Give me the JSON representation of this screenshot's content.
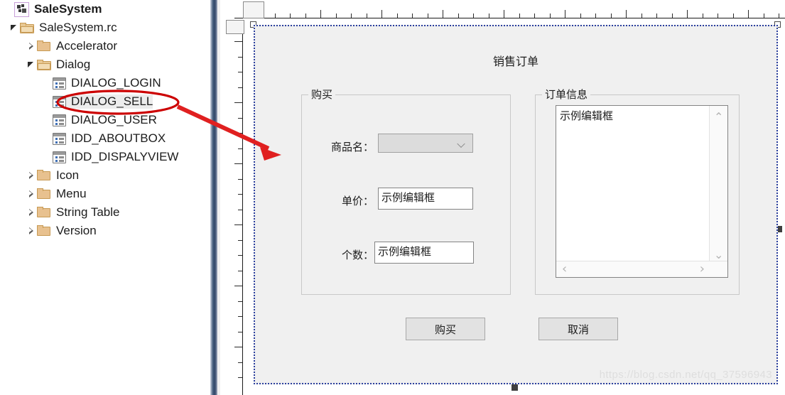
{
  "explorer": {
    "root": {
      "label": "SaleSystem",
      "icon": "project-icon"
    },
    "items": [
      {
        "label": "SaleSystem.rc",
        "icon": "folder-open-icon",
        "indent": 1,
        "expander": "expanded"
      },
      {
        "label": "Accelerator",
        "icon": "folder-icon",
        "indent": 2,
        "expander": "collapsed"
      },
      {
        "label": "Dialog",
        "icon": "folder-open-icon",
        "indent": 2,
        "expander": "expanded"
      },
      {
        "label": "DIALOG_LOGIN",
        "icon": "dialog-icon",
        "indent": 3,
        "expander": "none"
      },
      {
        "label": "DIALOG_SELL",
        "icon": "dialog-icon",
        "indent": 3,
        "expander": "none",
        "selected": true
      },
      {
        "label": "DIALOG_USER",
        "icon": "dialog-icon",
        "indent": 3,
        "expander": "none"
      },
      {
        "label": "IDD_ABOUTBOX",
        "icon": "dialog-icon",
        "indent": 3,
        "expander": "none"
      },
      {
        "label": "IDD_DISPALYVIEW",
        "icon": "dialog-icon",
        "indent": 3,
        "expander": "none"
      },
      {
        "label": "Icon",
        "icon": "folder-icon",
        "indent": 2,
        "expander": "collapsed"
      },
      {
        "label": "Menu",
        "icon": "folder-icon",
        "indent": 2,
        "expander": "collapsed"
      },
      {
        "label": "String Table",
        "icon": "folder-icon",
        "indent": 2,
        "expander": "collapsed"
      },
      {
        "label": "Version",
        "icon": "folder-icon",
        "indent": 2,
        "expander": "collapsed"
      }
    ]
  },
  "designer": {
    "dialog_title": "销售订单",
    "group_left": {
      "title": "购买"
    },
    "group_right": {
      "title": "订单信息"
    },
    "fields": [
      {
        "label": "商品名：",
        "control": "combo",
        "value": ""
      },
      {
        "label": "单价：",
        "control": "edit",
        "value": "示例编辑框"
      },
      {
        "label": "个数：",
        "control": "edit",
        "value": "示例编辑框"
      }
    ],
    "order_edit": {
      "value": "示例编辑框"
    },
    "scroll_icons": {
      "up": "▲",
      "down": "▼",
      "left": "‹",
      "right": "›"
    },
    "buttons": [
      {
        "label": "购买",
        "name": "buy-button"
      },
      {
        "label": "取消",
        "name": "cancel-button"
      }
    ]
  },
  "watermark": {
    "text": "https://blog.csdn.net/qq_37596943"
  },
  "annotation": {
    "highlight_target": "DIALOG_SELL",
    "color": "#cc0000"
  },
  "colors": {
    "accent_red": "#cc0000",
    "selection_border": "#2b3f9e",
    "dialog_face": "#f0f0f0",
    "folder": "#e8c18f"
  }
}
